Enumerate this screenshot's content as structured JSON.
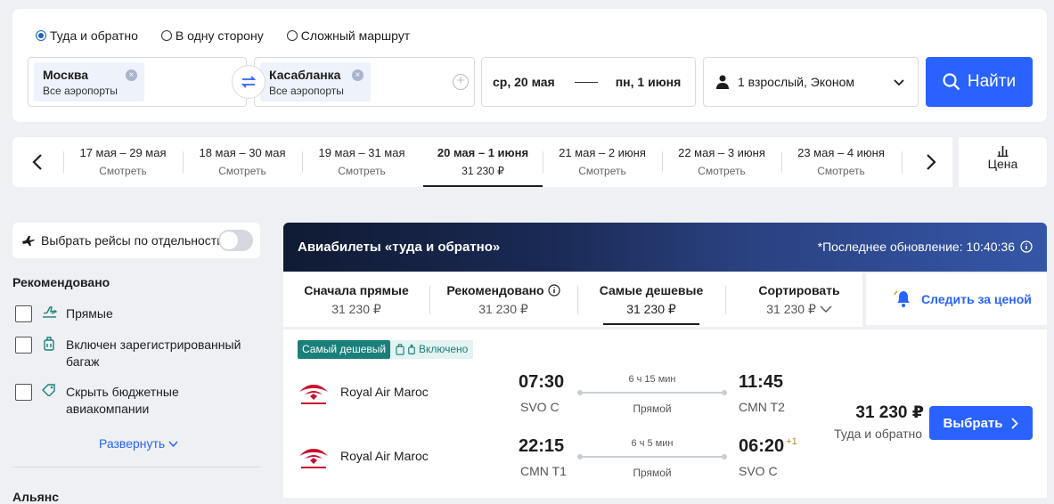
{
  "search": {
    "trip_types": [
      {
        "label": "Туда и обратно",
        "checked": true
      },
      {
        "label": "В одну сторону",
        "checked": false
      },
      {
        "label": "Сложный маршрут",
        "checked": false
      }
    ],
    "from": {
      "city": "Москва",
      "airports": "Все аэропорты"
    },
    "to": {
      "city": "Касабланка",
      "airports": "Все аэропорты"
    },
    "date_depart": "ср, 20 мая",
    "date_return": "пн, 1 июня",
    "passengers": "1 взрослый, Эконом",
    "find_label": "Найти"
  },
  "date_strip": {
    "items": [
      {
        "range": "17 мая – 29 мая",
        "sub": "Смотреть"
      },
      {
        "range": "18 мая – 30 мая",
        "sub": "Смотреть"
      },
      {
        "range": "19 мая – 31 мая",
        "sub": "Смотреть"
      },
      {
        "range": "20 мая – 1 июня",
        "sub": "31 230 ₽"
      },
      {
        "range": "21 мая – 2 июня",
        "sub": "Смотреть"
      },
      {
        "range": "22 мая – 3 июня",
        "sub": "Смотреть"
      },
      {
        "range": "23 мая – 4 июня",
        "sub": "Смотреть"
      }
    ],
    "price_tab": "Цена"
  },
  "sidebar": {
    "toggle_label": "Выбрать рейсы по отдельности",
    "section_title": "Рекомендовано",
    "filters": [
      {
        "label": "Прямые"
      },
      {
        "label": "Включен зарегистрированный багаж"
      },
      {
        "label": "Скрыть бюджетные авиакомпании"
      }
    ],
    "expand_label": "Развернуть",
    "next_section": "Альянс"
  },
  "results": {
    "title": "Авиабилеты «туда и обратно»",
    "last_update": "*Последнее обновление: 10:40:36",
    "sort_tabs": [
      {
        "label": "Сначала прямые",
        "price": "31 230 ₽"
      },
      {
        "label": "Рекомендовано",
        "price": "31 230 ₽"
      },
      {
        "label": "Самые дешевые",
        "price": "31 230 ₽"
      },
      {
        "label": "Сортировать",
        "price": "31 230 ₽"
      }
    ],
    "watch_price": "Следить за ценой",
    "ticket": {
      "badge_cheapest": "Самый дешевый",
      "badge_baggage": "Включено",
      "legs": [
        {
          "airline": "Royal Air Maroc",
          "dep_time": "07:30",
          "dep_airport": "SVO C",
          "duration": "6 ч 15 мин",
          "stops": "Прямой",
          "arr_time": "11:45",
          "arr_airport": "CMN T2",
          "day_shift": ""
        },
        {
          "airline": "Royal Air Maroc",
          "dep_time": "22:15",
          "dep_airport": "CMN T1",
          "duration": "6 ч 5 мин",
          "stops": "Прямой",
          "arr_time": "06:20",
          "arr_airport": "SVO C",
          "day_shift": "+1"
        }
      ],
      "price": "31 230 ₽",
      "price_note": "Туда и обратно",
      "select_label": "Выбрать"
    }
  }
}
